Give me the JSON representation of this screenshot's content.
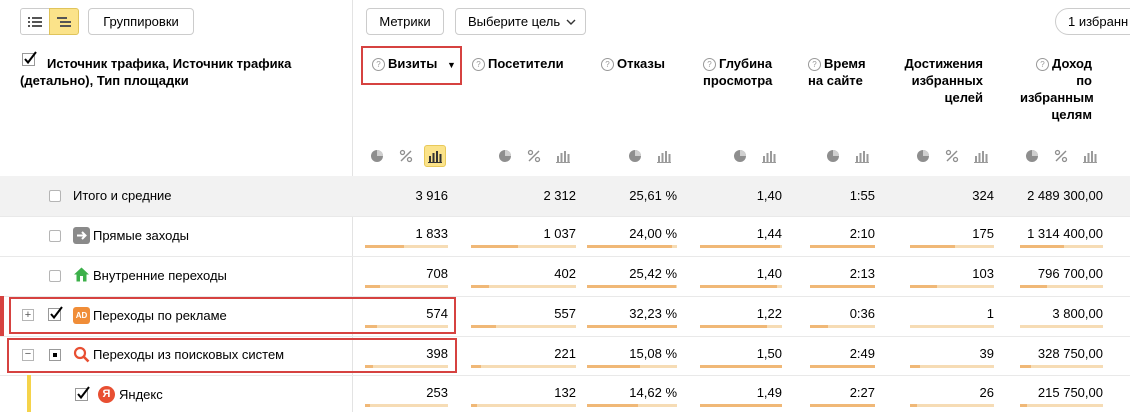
{
  "toolbar": {
    "groupings_label": "Группировки",
    "metrics_label": "Метрики",
    "goal_select_label": "Выберите цель",
    "favorites_label": "1 избранн"
  },
  "header": {
    "dimension_title": "Источник трафика, Источник трафика (детально), Тип площадки",
    "columns": [
      {
        "label": "Визиты",
        "sorted": true,
        "sort_glyph": "▼"
      },
      {
        "label": "Посетители"
      },
      {
        "label": "Отказы"
      },
      {
        "label": "Глубина просмотра"
      },
      {
        "label": "Время на сайте"
      },
      {
        "label": "Достижения избранных целей"
      },
      {
        "label": "Доход по избранным целям"
      }
    ]
  },
  "rows": [
    {
      "label": "Итого и средние",
      "icon": "none",
      "values": [
        "3 916",
        "2 312",
        "25,61 %",
        "1,40",
        "1:55",
        "324",
        "2 489 300,00"
      ],
      "bars": null
    },
    {
      "label": "Прямые заходы",
      "icon": "arrow-right-icon",
      "values": [
        "1 833",
        "1 037",
        "24,00 %",
        "1,44",
        "2:10",
        "175",
        "1 314 400,00"
      ],
      "bars": [
        0.468,
        0.448,
        0.94,
        0.97,
        1.0,
        0.54,
        0.53
      ]
    },
    {
      "label": "Внутренние переходы",
      "icon": "home-icon",
      "values": [
        "708",
        "402",
        "25,42 %",
        "1,40",
        "2:13",
        "103",
        "796 700,00"
      ],
      "bars": [
        0.181,
        0.174,
        0.99,
        0.94,
        1.0,
        0.32,
        0.32
      ]
    },
    {
      "label": "Переходы по рекламе",
      "icon": "ad-icon",
      "values": [
        "574",
        "557",
        "32,23 %",
        "1,22",
        "0:36",
        "1",
        "3 800,00"
      ],
      "bars": [
        0.147,
        0.241,
        1.0,
        0.82,
        0.27,
        0.003,
        0.002
      ]
    },
    {
      "label": "Переходы из поисковых систем",
      "icon": "search-icon",
      "values": [
        "398",
        "221",
        "15,08 %",
        "1,50",
        "2:49",
        "39",
        "328 750,00"
      ],
      "bars": [
        0.102,
        0.096,
        0.59,
        1.0,
        1.0,
        0.12,
        0.13
      ]
    },
    {
      "label": "Яндекс",
      "icon": "yandex-icon",
      "values": [
        "253",
        "132",
        "14,62 %",
        "1,49",
        "2:27",
        "26",
        "215 750,00"
      ],
      "bars": [
        0.065,
        0.057,
        0.57,
        1.0,
        1.0,
        0.08,
        0.09
      ]
    }
  ],
  "icons": {
    "ad_text": "AD",
    "yandex_letter": "Я"
  },
  "colors": {
    "highlight_red": "#d64240",
    "bar_fill": "#f0b877",
    "bar_track": "#f6dcb5",
    "yellow_accent": "#f5d34a",
    "ad_orange": "#f08d38",
    "home_green": "#3cb04a",
    "search_red": "#e84f32"
  }
}
